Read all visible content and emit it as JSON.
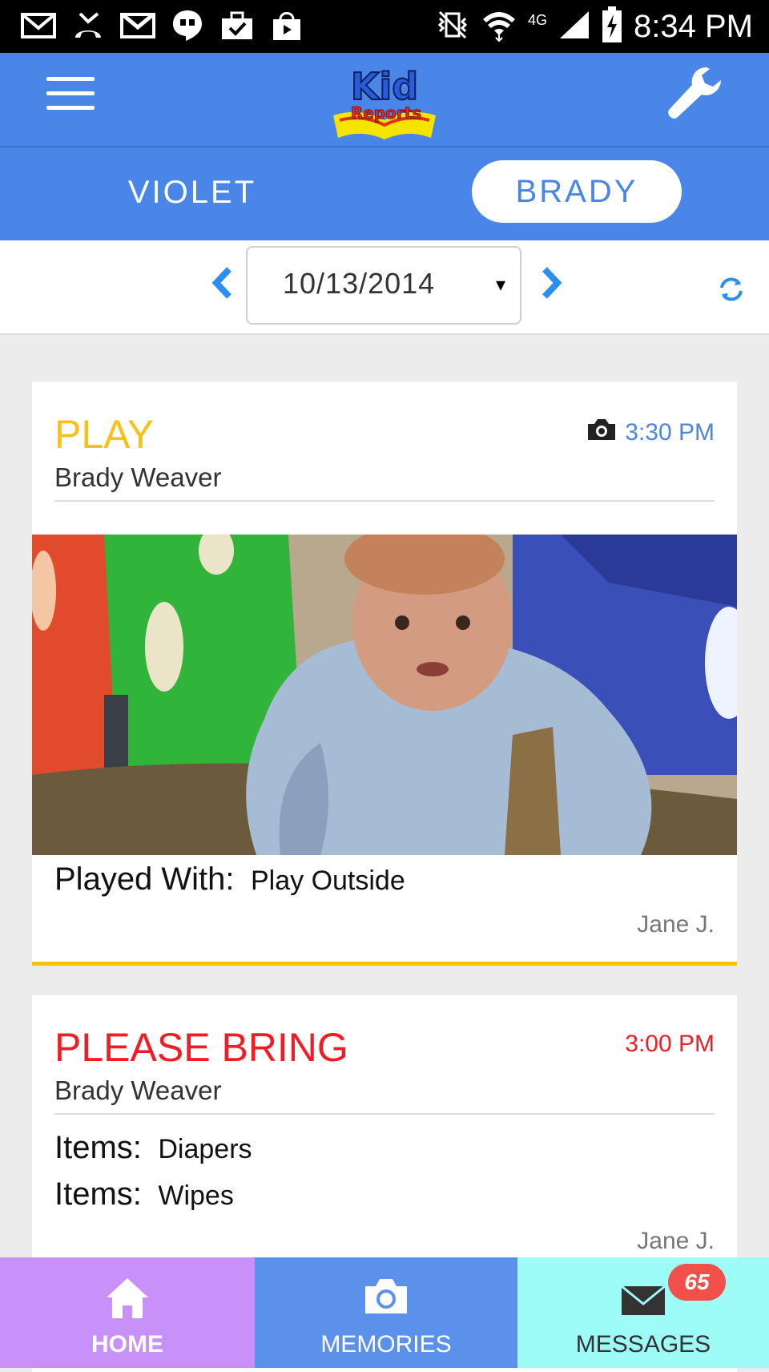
{
  "status_bar": {
    "time": "8:34 PM",
    "network": "4G",
    "icons": [
      "mail-icon",
      "missed-call-icon",
      "gmail-icon",
      "hangouts-icon",
      "briefcase-icon",
      "shopping-bag-icon",
      "vibrate-icon",
      "wifi-icon",
      "signal-icon",
      "battery-charging-icon"
    ]
  },
  "app_bar": {
    "logo_top": "Kid",
    "logo_bottom": "Reports",
    "menu_icon": "hamburger-menu-icon",
    "settings_icon": "wrench-icon"
  },
  "children": {
    "tabs": [
      {
        "label": "VIOLET",
        "selected": false
      },
      {
        "label": "BRADY",
        "selected": true
      }
    ]
  },
  "date_bar": {
    "date": "10/13/2014",
    "caret": "▾",
    "prev_icon": "chevron-left-icon",
    "next_icon": "chevron-right-icon",
    "refresh_icon": "refresh-icon"
  },
  "reports": [
    {
      "category": "PLAY",
      "category_color": "#f6c21a",
      "time": "3:30 PM",
      "has_photo": true,
      "child": "Brady Weaver",
      "fields": [
        {
          "label": "Played With:",
          "value": "Play Outside"
        }
      ],
      "staff": "Jane J."
    },
    {
      "category": "PLEASE BRING",
      "category_color": "#f21d24",
      "time": "3:00 PM",
      "child": "Brady Weaver",
      "fields": [
        {
          "label": "Items:",
          "value": "Diapers"
        },
        {
          "label": "Items:",
          "value": "Wipes"
        }
      ],
      "staff": "Jane J."
    }
  ],
  "bottom_nav": {
    "home": {
      "label": "HOME",
      "color": "#c891f9"
    },
    "memories": {
      "label": "MEMORIES",
      "color": "#5b91ea"
    },
    "messages": {
      "label": "MESSAGES",
      "badge": "65",
      "color": "#9efcf7"
    }
  },
  "colors": {
    "primary": "#4a86e8",
    "background": "#ececec"
  }
}
